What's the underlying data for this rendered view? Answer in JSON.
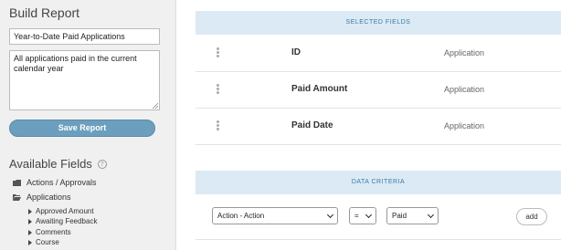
{
  "build": {
    "title": "Build Report",
    "report_name_value": "Year-to-Date Paid Applications",
    "description_value": "All applications paid in the current calendar year",
    "save_label": "Save Report"
  },
  "available": {
    "title": "Available Fields",
    "help_glyph": "?",
    "folders": [
      {
        "label": "Actions / Approvals",
        "icon": "folder-closed-icon"
      },
      {
        "label": "Applications",
        "icon": "folder-open-icon"
      }
    ],
    "children": [
      "Approved Amount",
      "Awaiting Feedback",
      "Comments",
      "Course"
    ]
  },
  "selected": {
    "heading": "SELECTED FIELDS",
    "fields": [
      {
        "name": "ID",
        "type": "Application"
      },
      {
        "name": "Paid Amount",
        "type": "Application"
      },
      {
        "name": "Paid Date",
        "type": "Application"
      }
    ]
  },
  "criteria": {
    "heading": "DATA CRITERIA",
    "field_select": "Action - Action",
    "operator_select": "=",
    "value_select": "Paid",
    "add_label": "add"
  },
  "colors": {
    "accent": "#6c9fbe",
    "section_bg": "#dbeaf5",
    "section_text": "#3b7aa6"
  }
}
